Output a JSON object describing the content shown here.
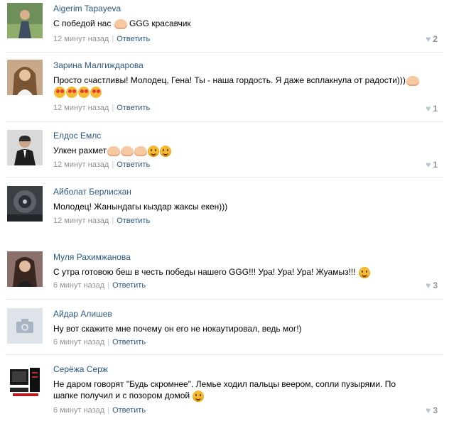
{
  "comments": [
    {
      "author": "Aigerim Tapayeva",
      "text_before": "С победой нас ",
      "text_after": " GGG красавчик",
      "time": "12 минут назад",
      "reply_label": "Ответить",
      "likes": "2",
      "avatar_icon": "photo-avatar"
    },
    {
      "author": "Зарина Малгиждарова",
      "text": "Просто счастливы! Молодец, Гена! Ты - наша гордость. Я даже всплакнула от радости)))",
      "time": "12 минут назад",
      "reply_label": "Ответить",
      "likes": "1",
      "avatar_icon": "photo-avatar"
    },
    {
      "author": "Елдос Емлс",
      "text": "Улкен рахмет",
      "time": "12 минут назад",
      "reply_label": "Ответить",
      "likes": "1",
      "avatar_icon": "photo-avatar"
    },
    {
      "author": "Айболат Берлисхан",
      "text": "Молодец! Жанындагы кыздар жаксы екен)))",
      "time": "12 минут назад",
      "reply_label": "Ответить",
      "avatar_icon": "photo-avatar"
    },
    {
      "author": "Муля Рахимжанова",
      "text": "С утра готовою беш в честь победы нашего GGG!!! Ура! Ура! Ура! Жуамыз!!! ",
      "time": "6 минут назад",
      "reply_label": "Ответить",
      "likes": "3",
      "avatar_icon": "photo-avatar"
    },
    {
      "author": "Айдар Алишев",
      "text": "Ну вот скажите мне почему он его не нокаутировал, ведь мог!)",
      "time": "6 минут назад",
      "reply_label": "Ответить",
      "avatar_icon": "camera-placeholder-icon"
    },
    {
      "author": "Серёжа Серж",
      "text": "Не даром говорят \"Будь скромнее\". Лемье ходил пальцы веером, сопли пузырями. По шапке получил и с позором домой ",
      "time": "6 минут назад",
      "reply_label": "Ответить",
      "likes": "3",
      "avatar_icon": "computer-avatar"
    }
  ],
  "colors": {
    "author_link": "#2a5885",
    "meta_gray": "#939393",
    "separator": "#e7e8ec",
    "like_heart": "#b6c3d2"
  },
  "like_icon": "heart-icon"
}
